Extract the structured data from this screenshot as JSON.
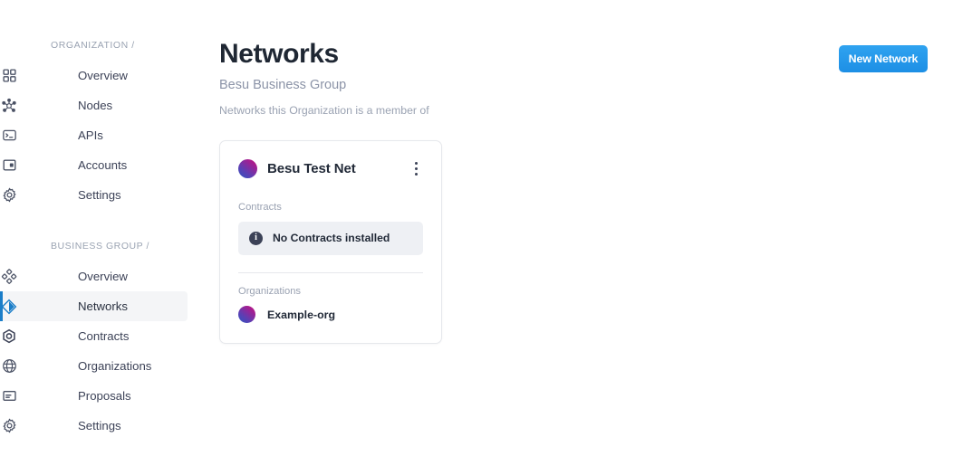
{
  "sidebar": {
    "groups": [
      {
        "label": "ORGANIZATION /",
        "items": [
          {
            "label": "Overview",
            "icon": "grid-icon",
            "active": false
          },
          {
            "label": "Nodes",
            "icon": "nodes-icon",
            "active": false
          },
          {
            "label": "APIs",
            "icon": "terminal-icon",
            "active": false
          },
          {
            "label": "Accounts",
            "icon": "wallet-icon",
            "active": false
          },
          {
            "label": "Settings",
            "icon": "gear-icon",
            "active": false
          }
        ]
      },
      {
        "label": "BUSINESS GROUP /",
        "items": [
          {
            "label": "Overview",
            "icon": "diamond-grid-icon",
            "active": false
          },
          {
            "label": "Networks",
            "icon": "diamond-icon",
            "active": true
          },
          {
            "label": "Contracts",
            "icon": "hexagon-icon",
            "active": false
          },
          {
            "label": "Organizations",
            "icon": "globe-icon",
            "active": false
          },
          {
            "label": "Proposals",
            "icon": "document-icon",
            "active": false
          },
          {
            "label": "Settings",
            "icon": "gear-icon",
            "active": false
          }
        ]
      }
    ]
  },
  "header": {
    "title": "Networks",
    "subtitle": "Besu Business Group",
    "description": "Networks this Organization is a member of",
    "new_network_label": "New Network"
  },
  "cards": [
    {
      "name": "Besu Test Net",
      "avatar_icon": "network-avatar",
      "menu_icon": "kebab-menu-icon",
      "contracts_label": "Contracts",
      "contracts_notice": "No Contracts installed",
      "contracts_notice_icon": "info-icon",
      "organizations_label": "Organizations",
      "organizations": [
        {
          "name": "Example-org",
          "avatar_icon": "org-avatar"
        }
      ]
    }
  ],
  "colors": {
    "accent_blue": "#1d8fe5",
    "active_indicator": "#1b7ec9",
    "text_dark": "#222a38",
    "text_muted": "#9aa2b2",
    "notice_bg": "#eef0f4"
  }
}
